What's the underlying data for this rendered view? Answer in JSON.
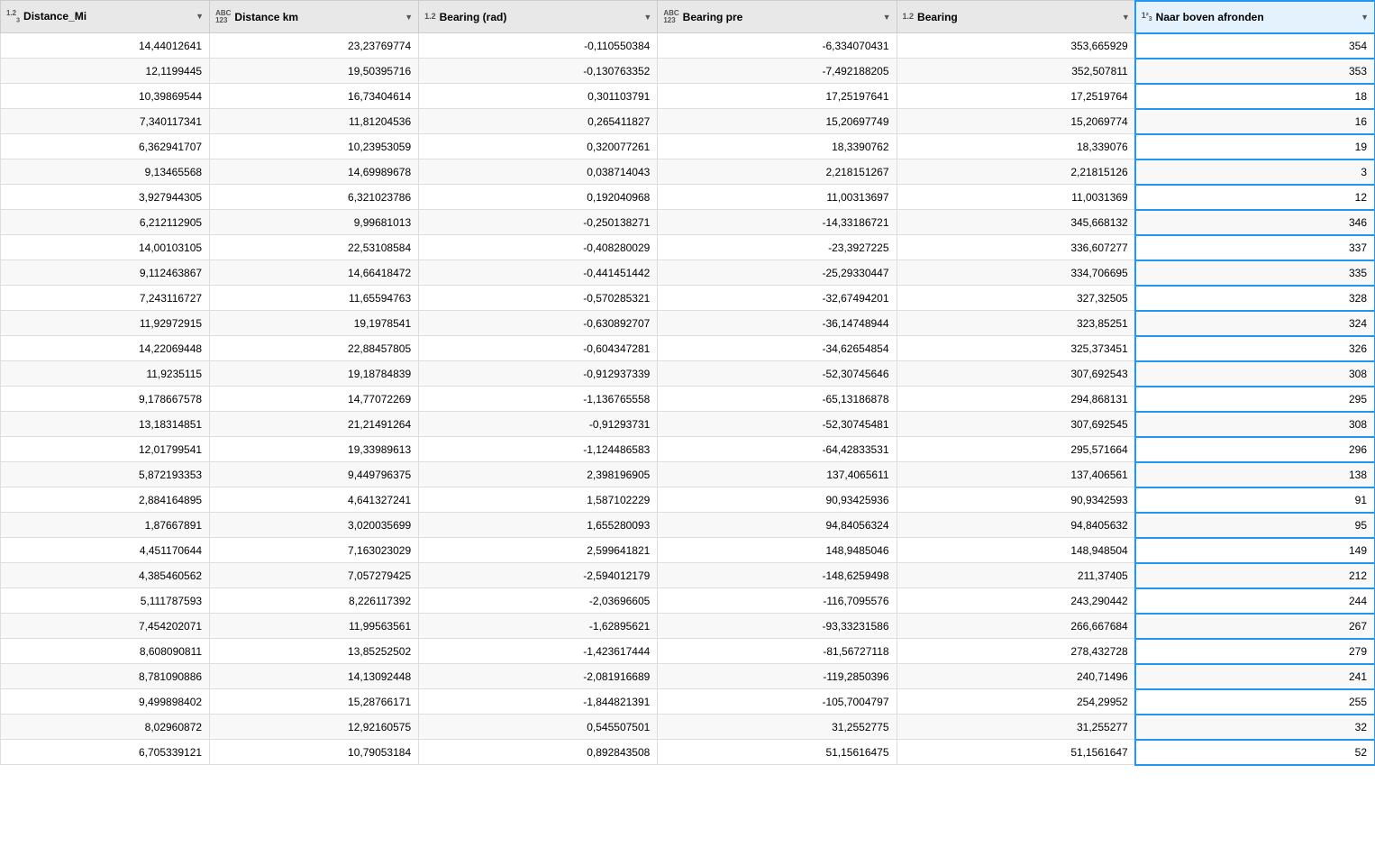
{
  "columns": [
    {
      "id": "distance_mi",
      "label": "Distance_Mi",
      "type": "1.2",
      "class": "col1"
    },
    {
      "id": "distance_km",
      "label": "Distance km",
      "type": "ABC\n123",
      "class": "col2"
    },
    {
      "id": "bearing_rad",
      "label": "Bearing (rad)",
      "type": "1.2",
      "class": "col3"
    },
    {
      "id": "bearing_pre",
      "label": "Bearing pre",
      "type": "ABC\n123",
      "class": "col4"
    },
    {
      "id": "bearing",
      "label": "Bearing",
      "type": "1.2",
      "class": "col5"
    },
    {
      "id": "naar_boven",
      "label": "Naar boven afronden",
      "type": "1²3",
      "class": "col6"
    }
  ],
  "rows": [
    [
      14.44012641,
      23.23769774,
      -0.110550384,
      -6.334070431,
      353.665929,
      354
    ],
    [
      12.1199445,
      19.50395716,
      -0.130763352,
      -7.492188205,
      352.507811,
      353
    ],
    [
      10.39869544,
      16.73404614,
      0.301103791,
      17.25197641,
      17.2519764,
      18
    ],
    [
      7.340117341,
      11.81204536,
      0.265411827,
      15.20697749,
      15.2069774,
      16
    ],
    [
      6.362941707,
      10.23953059,
      0.320077261,
      18.3390762,
      18.339076,
      19
    ],
    [
      9.13465568,
      14.69989678,
      0.038714043,
      2.218151267,
      2.21815126,
      3
    ],
    [
      3.927944305,
      6.321023786,
      0.192040968,
      11.00313697,
      11.0031369,
      12
    ],
    [
      6.212112905,
      9.99681013,
      -0.250138271,
      -14.33186721,
      345.668132,
      346
    ],
    [
      14.00103105,
      22.53108584,
      -0.408280029,
      -23.3927225,
      336.607277,
      337
    ],
    [
      9.112463867,
      14.66418472,
      -0.441451442,
      -25.29330447,
      334.706695,
      335
    ],
    [
      7.243116727,
      11.65594763,
      -0.570285321,
      -32.67494201,
      327.32505,
      328
    ],
    [
      11.92972915,
      19.1978541,
      -0.630892707,
      -36.14748944,
      323.85251,
      324
    ],
    [
      14.22069448,
      22.88457805,
      -0.604347281,
      -34.62654854,
      325.373451,
      326
    ],
    [
      11.9235115,
      19.18784839,
      -0.912937339,
      -52.30745646,
      307.692543,
      308
    ],
    [
      9.178667578,
      14.77072269,
      -1.136765558,
      -65.13186878,
      294.868131,
      295
    ],
    [
      13.18314851,
      21.21491264,
      -0.91293731,
      -52.30745481,
      307.692545,
      308
    ],
    [
      12.01799541,
      19.33989613,
      -1.124486583,
      -64.42833531,
      295.571664,
      296
    ],
    [
      5.872193353,
      9.449796375,
      2.398196905,
      137.4065611,
      137.406561,
      138
    ],
    [
      2.884164895,
      4.641327241,
      1.587102229,
      90.93425936,
      90.9342593,
      91
    ],
    [
      1.87667891,
      3.020035699,
      1.655280093,
      94.84056324,
      94.8405632,
      95
    ],
    [
      4.451170644,
      7.163023029,
      2.599641821,
      148.9485046,
      148.948504,
      149
    ],
    [
      4.385460562,
      7.057279425,
      -2.594012179,
      -148.6259498,
      211.37405,
      212
    ],
    [
      5.111787593,
      8.226117392,
      -2.03696605,
      -116.7095576,
      243.290442,
      244
    ],
    [
      7.454202071,
      11.99563561,
      -1.62895621,
      -93.33231586,
      266.667684,
      267
    ],
    [
      8.608090811,
      13.85252502,
      -1.423617444,
      -81.56727118,
      278.432728,
      279
    ],
    [
      8.781090886,
      14.13092448,
      -2.081916689,
      -119.2850396,
      240.71496,
      241
    ],
    [
      9.499898402,
      15.28766171,
      -1.844821391,
      -105.7004797,
      254.29952,
      255
    ],
    [
      8.02960872,
      12.92160575,
      0.545507501,
      31.2552775,
      31.255277,
      32
    ],
    [
      6.705339121,
      10.79053184,
      0.892843508,
      51.15616475,
      51.1561647,
      52
    ]
  ]
}
